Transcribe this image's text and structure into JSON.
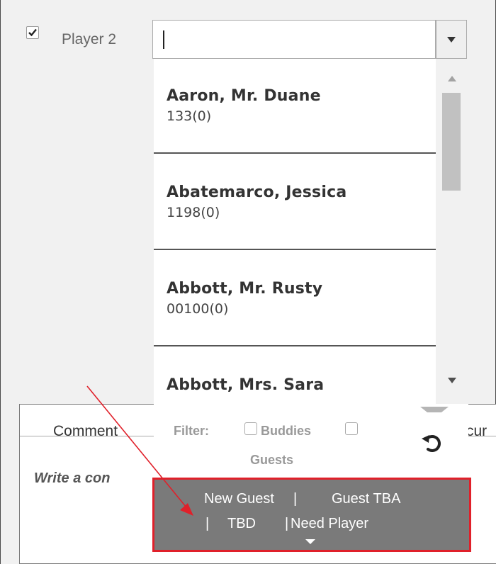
{
  "player_row": {
    "checked": true,
    "label": "Player 2",
    "search_value": "",
    "dropdown_icon": "caret-down-icon"
  },
  "member_list": {
    "items": [
      {
        "name": "Aaron, Mr. Duane",
        "sub": "133(0)"
      },
      {
        "name": "Abatemarco, Jessica",
        "sub": "1198(0)"
      },
      {
        "name": "Abbott, Mr. Rusty",
        "sub": "00100(0)"
      },
      {
        "name": "Abbott, Mrs. Sara",
        "sub": ""
      }
    ]
  },
  "filter": {
    "label": "Filter:",
    "buddies_label": "Buddies",
    "guests_label": "Guests",
    "reset_icon": "undo-icon"
  },
  "guest_options": {
    "new_guest": "New Guest",
    "guest_tba": "Guest TBA",
    "tbd": "TBD",
    "need_player": "Need Player",
    "separator": "|"
  },
  "comments": {
    "tab_comment": "Comment",
    "tab_recurring": "cur",
    "input_placeholder": "Write a con"
  },
  "colors": {
    "annotation": "#e0202a",
    "guest_bar": "#7a7a7a"
  }
}
